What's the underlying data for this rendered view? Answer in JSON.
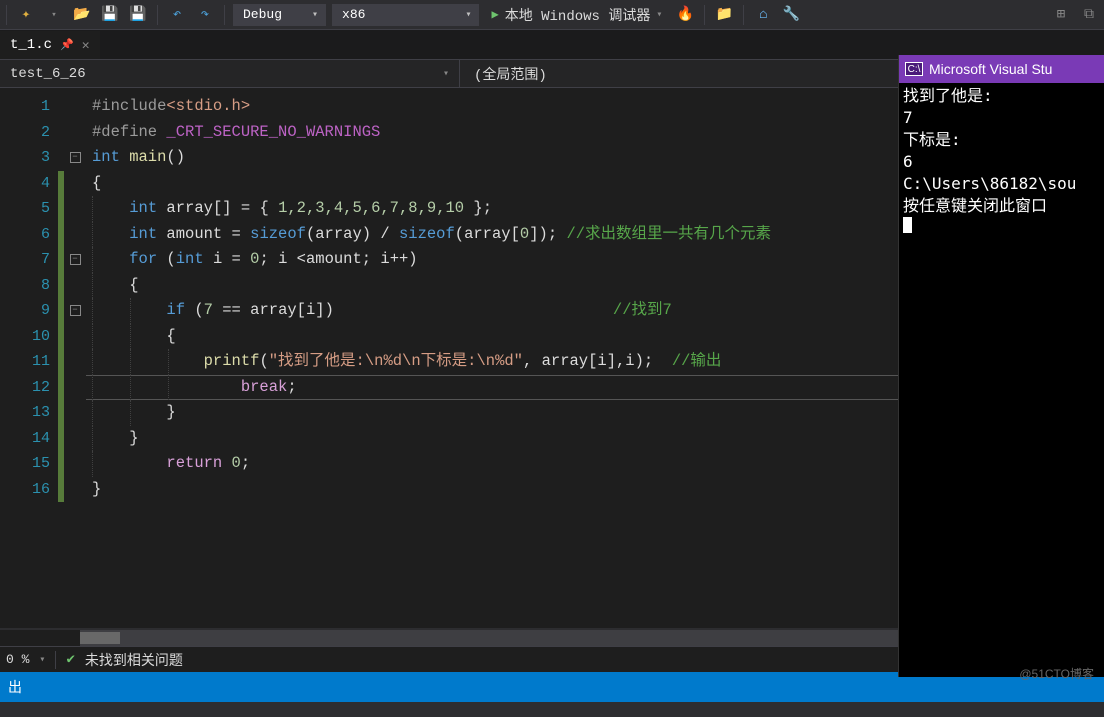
{
  "toolbar": {
    "config": "Debug",
    "platform": "x86",
    "run_label": "本地 Windows 调试器"
  },
  "tab": {
    "filename": "t_1.c"
  },
  "nav": {
    "project": "test_6_26",
    "scope": "(全局范围)"
  },
  "code": {
    "l1_pp": "#include",
    "l1_inc": "<stdio.h>",
    "l2_pp": "#define ",
    "l2_mac": "_CRT_SECURE_NO_WARNINGS",
    "l3_kw": "int",
    "l3_fn": " main",
    "l3_par": "()",
    "l4": "{",
    "l5_a": "int",
    "l5_b": " array",
    "l5_c": "[] = { ",
    "l5_nums": "1,2,3,4,5,6,7,8,9,10",
    "l5_d": " };",
    "l6_a": "int",
    "l6_b": " amount = ",
    "l6_c": "sizeof",
    "l6_d": "(array) / ",
    "l6_e": "sizeof",
    "l6_f": "(array[",
    "l6_g": "0",
    "l6_h": "]); ",
    "l6_cmt": "//求出数组里一共有几个元素",
    "l7_a": "for",
    "l7_b": " (",
    "l7_c": "int",
    "l7_d": " i = ",
    "l7_e": "0",
    "l7_f": "; i <amount; i++)",
    "l8": "{",
    "l9_a": "if",
    "l9_b": " (",
    "l9_c": "7",
    "l9_d": " == array[i])",
    "l9_cmt": "//找到7",
    "l10": "{",
    "l11_a": "printf",
    "l11_b": "(",
    "l11_str": "\"找到了他是:\\n%d\\n下标是:\\n%d\"",
    "l11_c": ", array[i],i);  ",
    "l11_cmt": "//输出",
    "l12_a": "break",
    "l12_b": ";",
    "l13": "}",
    "l14": "}",
    "l15_a": "return",
    "l15_b": " 0",
    "l15_c": ";",
    "l16": "}"
  },
  "status": {
    "zoom": "0 %",
    "issues": "未找到相关问题"
  },
  "bottom": {
    "text": "出"
  },
  "console": {
    "title": "Microsoft Visual Stu",
    "line1": "找到了他是:",
    "line2": "7",
    "line3": "下标是:",
    "line4": "6",
    "line5": "C:\\Users\\86182\\sou",
    "line6": "按任意键关闭此窗口"
  },
  "watermark": "@51CTO博客"
}
